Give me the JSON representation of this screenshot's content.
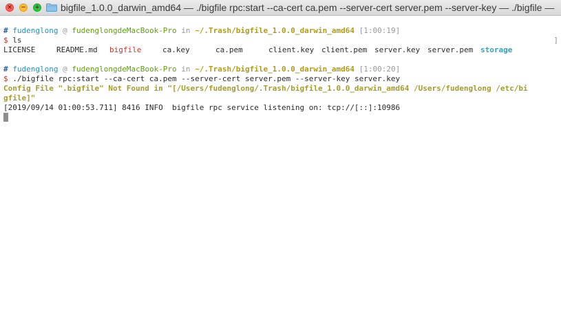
{
  "window": {
    "title": "bigfile_1.0.0_darwin_amd64 — ./bigfile rpc:start --ca-cert ca.pem --server-cert server.pem --server-key  — ./bigfile — bi…"
  },
  "terminal": {
    "prompt1": {
      "hash": "#",
      "user": "fudenglong",
      "at": "@",
      "host": "fudenglongdeMacBook-Pro",
      "in": "in",
      "path": "~/.Trash/bigfile_1.0.0_darwin_amd64",
      "time": "[1:00:19]",
      "dollar": "$",
      "command": "ls"
    },
    "ls_output": [
      {
        "text": "LICENSE",
        "kind": "plain"
      },
      {
        "text": "README.md",
        "kind": "plain"
      },
      {
        "text": "bigfile",
        "kind": "exec"
      },
      {
        "text": "ca.key",
        "kind": "plain"
      },
      {
        "text": "ca.pem",
        "kind": "plain"
      },
      {
        "text": "client.key",
        "kind": "plain"
      },
      {
        "text": "client.pem",
        "kind": "plain"
      },
      {
        "text": "server.key",
        "kind": "plain"
      },
      {
        "text": "server.pem",
        "kind": "plain"
      },
      {
        "text": "storage",
        "kind": "dir"
      }
    ],
    "prompt2": {
      "hash": "#",
      "user": "fudenglong",
      "at": "@",
      "host": "fudenglongdeMacBook-Pro",
      "in": "in",
      "path": "~/.Trash/bigfile_1.0.0_darwin_amd64",
      "time": "[1:00:20]",
      "dollar": "$",
      "command": "./bigfile rpc:start --ca-cert ca.pem --server-cert server.pem --server-key server.key"
    },
    "error_line1": "Config File \".bigfile\" Not Found in \"[/Users/fudenglong/.Trash/bigfile_1.0.0_darwin_amd64 /Users/fudenglong /etc/bi",
    "error_line2": "gfile]\"",
    "log_line": "[2019/09/14 01:00:53.711] 8416 INFO  bigfile rpc service listening on: tcp://[::]:10986",
    "edge_marker": "]"
  },
  "colors": {
    "hash": "#2a5fb3",
    "user": "#2a8fbd",
    "host": "#5fa012",
    "path": "#b09c1a",
    "dollar": "#c2362b",
    "exec_file": "#c0392b",
    "directory": "#3aa0b5",
    "error": "#a59b2e"
  }
}
